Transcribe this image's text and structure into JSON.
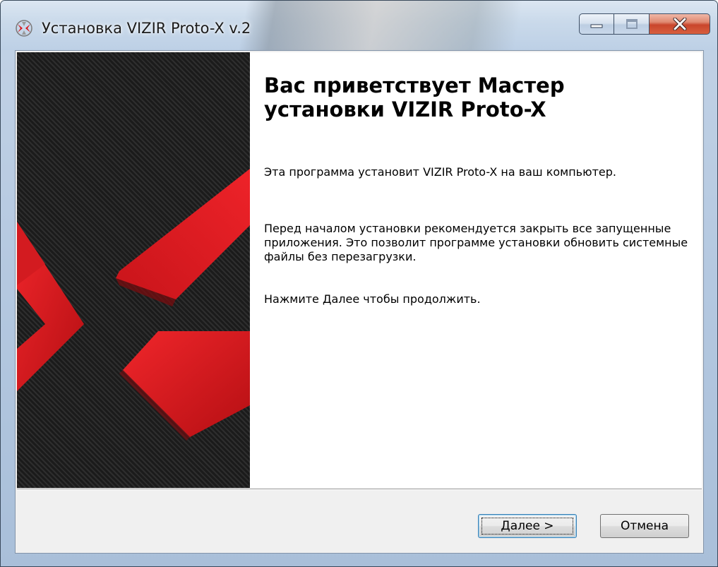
{
  "window": {
    "title": "Установка VIZIR Proto-X v.2",
    "app_icon": "vizir-logo-icon",
    "controls": {
      "minimize_icon": "minimize-icon",
      "maximize_icon": "maximize-icon",
      "close_icon": "close-icon"
    }
  },
  "banner": {
    "image": "vizir-red-x-carbon-banner",
    "colors": {
      "background": "#1b1b1b",
      "accent": "#e0191e"
    }
  },
  "welcome": {
    "heading": "Вас приветствует Мастер установки VIZIR Proto-X",
    "paragraphs": [
      "Эта программа установит VIZIR Proto-X на ваш компьютер.",
      "Перед началом установки рекомендуется закрыть все запущенные приложения. Это позволит программе установки обновить системные файлы без перезагрузки.",
      "Нажмите Далее чтобы продолжить."
    ]
  },
  "buttons": {
    "next_label": "Далее >",
    "cancel_label": "Отмена"
  }
}
